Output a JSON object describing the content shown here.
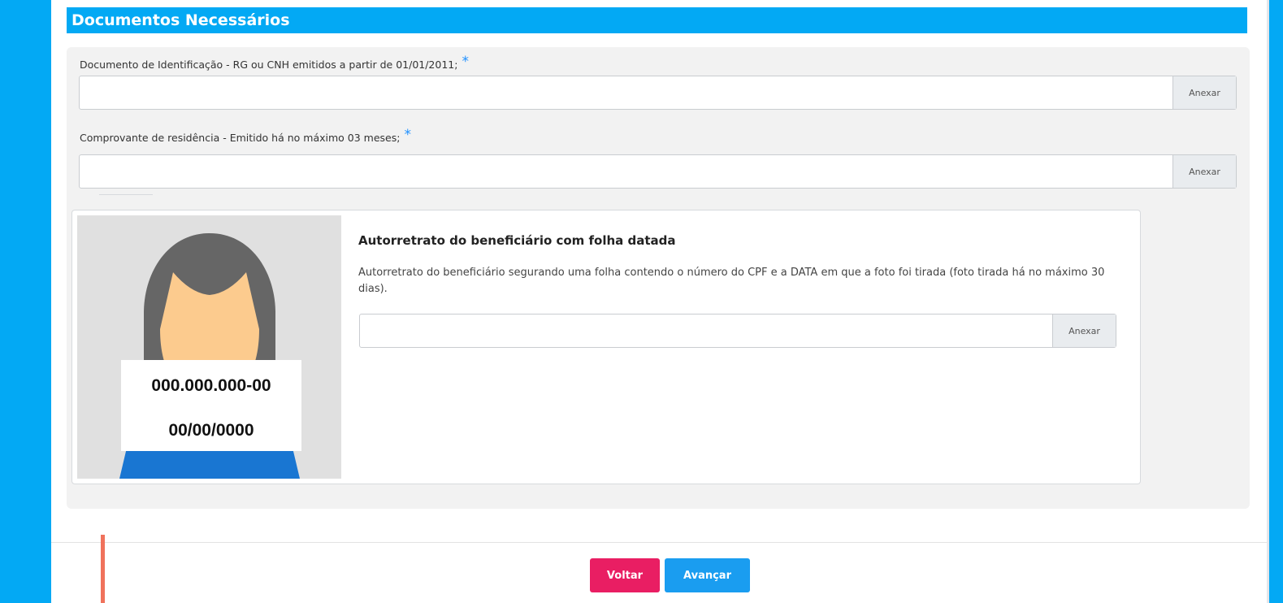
{
  "section": {
    "title": "Documentos Necessários"
  },
  "fields": [
    {
      "label": "Documento de Identificação - RG ou CNH emitidos a partir de 01/01/2011;",
      "required_mark": "*",
      "value": "",
      "attach_label": "Anexar"
    },
    {
      "label": "Comprovante de residência - Emitido há no máximo 03 meses;",
      "required_mark": "*",
      "value": "",
      "attach_label": "Anexar"
    }
  ],
  "selfie": {
    "title": "Autorretrato do beneficiário com folha datada",
    "description": "Autorretrato do beneficiário segurando uma folha contendo o número do CPF e a DATA em que a foto foi tirada (foto tirada há no máximo 30 dias).",
    "value": "",
    "attach_label": "Anexar",
    "sample_cpf": "000.000.000-00",
    "sample_date": "00/00/0000"
  },
  "actions": {
    "back_label": "Voltar",
    "next_label": "Avançar"
  },
  "colors": {
    "accent": "#03a9f4",
    "back": "#e91e63",
    "next": "#1a9df0",
    "hair": "#666666",
    "skin": "#fccb8e",
    "shirt": "#1976d2"
  }
}
